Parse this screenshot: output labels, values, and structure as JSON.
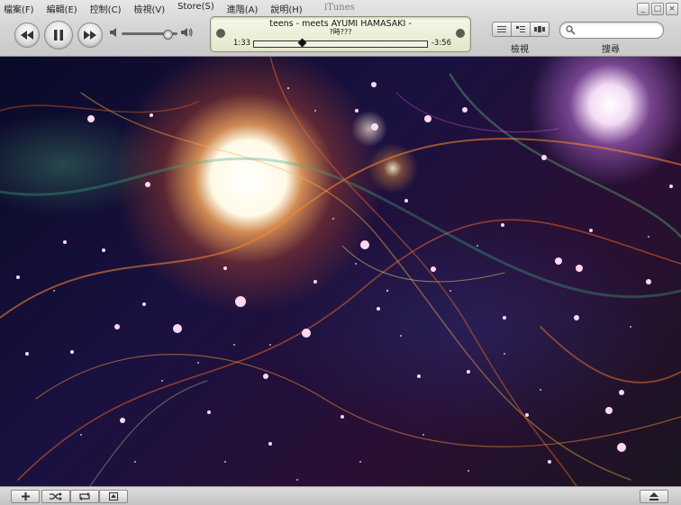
{
  "window": {
    "title": "iTunes"
  },
  "menu": {
    "items": [
      {
        "label": "檔案(F)"
      },
      {
        "label": "編輯(E)"
      },
      {
        "label": "控制(C)"
      },
      {
        "label": "檢視(V)"
      },
      {
        "label": "Store(S)"
      },
      {
        "label": "進階(A)"
      },
      {
        "label": "說明(H)"
      }
    ]
  },
  "window_controls": {
    "minimize": "_",
    "maximize": "□",
    "close": "×"
  },
  "player": {
    "volume_level": 0.8,
    "now_playing": {
      "line1": "teens - meets AYUMI HAMASAKI -",
      "line2": "?時???",
      "elapsed": "1:33",
      "remaining": "-3:56",
      "progress": 0.28
    }
  },
  "view": {
    "label": "檢視"
  },
  "search": {
    "label": "搜尋",
    "placeholder": "",
    "value": ""
  },
  "icons": {
    "previous": "previous-track-icon",
    "pause": "pause-icon",
    "next": "next-track-icon",
    "volume_low": "speaker-low-icon",
    "volume_high": "speaker-high-icon",
    "search": "magnifier-icon",
    "add": "plus-icon",
    "shuffle": "shuffle-icon",
    "repeat": "repeat-icon",
    "artwork": "show-artwork-icon",
    "eject": "eject-icon"
  },
  "colors": {
    "lcd": "#eceed6",
    "chrome": "#d0d0d0"
  }
}
